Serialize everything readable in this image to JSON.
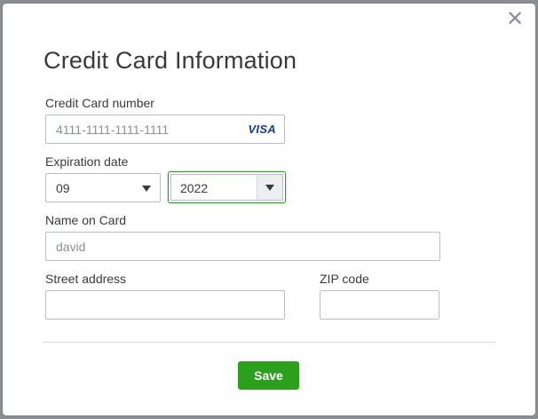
{
  "dialog": {
    "title": "Credit Card Information",
    "close_glyph": "✕"
  },
  "card_number": {
    "label": "Credit Card number",
    "placeholder": "4111-1111-1111-1111",
    "brand": "VISA"
  },
  "expiration": {
    "label": "Expiration date",
    "month": "09",
    "year": "2022"
  },
  "name_on_card": {
    "label": "Name on Card",
    "placeholder": "david"
  },
  "street_address": {
    "label": "Street address",
    "value": ""
  },
  "zip": {
    "label": "ZIP code",
    "value": ""
  },
  "actions": {
    "save_label": "Save"
  },
  "colors": {
    "accent": "#2ca01c",
    "text": "#393a3d",
    "placeholder": "#8d9096",
    "visa_blue": "#1a3a8c"
  },
  "icons": {
    "close": "close-icon",
    "dropdown": "chevron-down-icon",
    "card_brand": "visa-logo-icon"
  }
}
